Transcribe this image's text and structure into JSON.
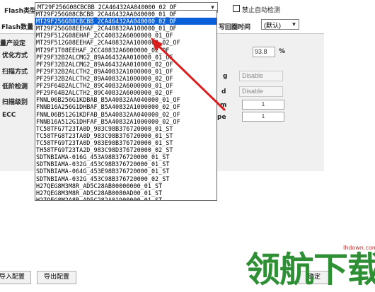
{
  "top": {
    "flash_type_label": "Flash类型",
    "flash_type_value": "MT29F256G08CBCBB_2CA46432AA040000_02_OF",
    "disable_auto_detect_label": "禁止自动检测",
    "flash_count_label": "Flash数量",
    "writeback_time_label": "写回圈时间",
    "writeback_time_value": "(默认)"
  },
  "left_labels": {
    "production_settings": "量产设定",
    "optimize_mode": "优化方式",
    "scan_mode": "扫描方式",
    "low_level_check": "低阶检测",
    "scan_level": "扫描级别",
    "ecc": "ECC"
  },
  "right_panel": {
    "percent_value": "93.8",
    "percent_unit": "%",
    "partial_label_1": "g",
    "partial_label_2": "d",
    "partial_label_3": "m",
    "partial_label_4": "pe",
    "disable_1": "Disable",
    "disable_2": "Disable",
    "num_1": "1",
    "num_2": "1"
  },
  "dropdown_items": [
    "MT29F256G08CBCBB_2CA46432AA040000_01_OF",
    "MT29F256G08CBCBB_2CA46432AA040000_02_OF",
    "MT29F256G08EEHAF_2CA40832AA100000_01_OF",
    "MT29F512G08EHAF_2CC40832A6000000_01_OF",
    "MT29F512G08EEHAF_2CA40832AA1000000_02_OF",
    "MT29F1T08EEHAF_2CC40832A6000000_02_OF",
    "PF29F32B2ALCMG2_89A46432AA010000_01_OF",
    "PF29F32B2ALCMG2_89A46432AA010000_02_OF",
    "PF29F32B2ALCTH2_89A40832A1000000_01_OF",
    "PF29F32B2ALCTH2_89A40832A1000000_02_OF",
    "PF29F64B2ALCTH2_89C40832A6000000_01_OF",
    "PF29F64B2ALCTH2_89C40832A6000000_02_OF",
    "FNNL06B256G1KDBAB_B5A40832AA040000_01_OF",
    "FNNB16A256G1DHBAF_B5A40832A1000000_02_OF",
    "FNNL06B512G1KDFAB_B5A40832AA040000_02_OF",
    "FNNB16A512G1DHFAF_B5A40832A1000000_02_OF",
    "TC58TFG7T23TA0D_983C98B376720000_01_ST",
    "TC58TFG8T23TA0D_983C98B376720000_01_ST",
    "TC58TFG9T23TA0D_983E98B376720000_01_ST",
    "TH58TFG9T23TA2D_983C98D376720000_02_ST",
    "SDTNBIAMA-016G_453A98B376720000_01_ST",
    "SDTNBIAMA-032G_453C98B376720000_01_ST",
    "SDTNBIAMA-064G_453E98B376720000_01_ST",
    "SDTNBIAMA-032G_453C98B376720000_02_ST",
    "H27QEG8M3M8R_AD5C28AB00000000_01_ST",
    "H27QEG8M3M8R_AD5C28AB0080AD00_01_ST",
    "H27QEG8M2A8R_AD5C282A01900000_01_ST"
  ],
  "selected_index": 1,
  "bottom": {
    "import_config": "导入配置",
    "export_config": "导出配置",
    "partial_button": "确定"
  },
  "watermark": {
    "text": "领航下载",
    "url": "lhdown.com"
  },
  "colors": {
    "selection_blue": "#0a60d8",
    "arrow_red": "#d81e1e",
    "watermark_green": "#2e8f35"
  }
}
